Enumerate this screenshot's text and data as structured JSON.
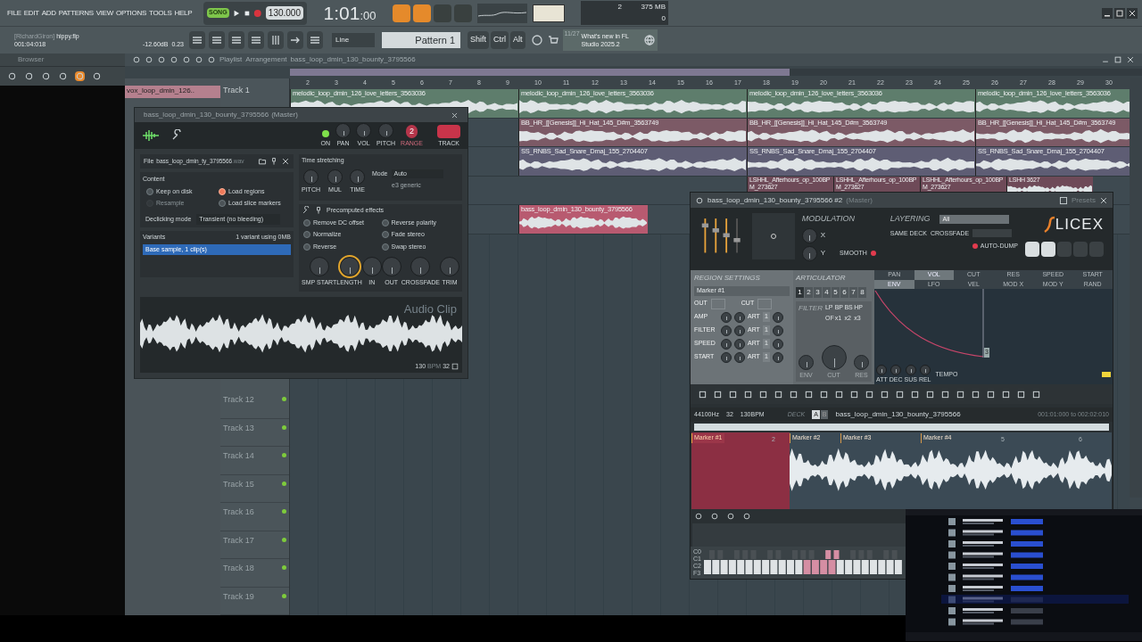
{
  "menu": [
    "FILE",
    "EDIT",
    "ADD",
    "PATTERNS",
    "VIEW",
    "OPTIONS",
    "TOOLS",
    "HELP"
  ],
  "transport": {
    "mode_label": "SONG",
    "song_mode": true,
    "tempo": "130.000",
    "time": "1:01",
    "time_ticks": ":00"
  },
  "project": {
    "user": "[RichardGiron]",
    "file": "hippy.flp",
    "position": "001:04:018",
    "volume": "-12.60dB",
    "pitch": "0.23"
  },
  "snap": "Line",
  "pattern": "Pattern 1",
  "modifiers": [
    "Shift",
    "Ctrl",
    "Alt"
  ],
  "resources": {
    "voices": "2",
    "memory": "375 MB",
    "polyphony": "0"
  },
  "news": {
    "counter": "11/27",
    "text": "What's new in FL Studio 2025.2"
  },
  "browser": {
    "title": "Browser"
  },
  "playlist": {
    "breadcrumb": [
      "Playlist",
      "Arrangement",
      "bass_loop_dmin_130_bounty_3795566"
    ],
    "picker": [
      {
        "label": "vox_loop_dmin_126..",
        "selected": true
      }
    ],
    "ruler": [
      "2",
      "3",
      "4",
      "5",
      "6",
      "7",
      "8",
      "9",
      "10",
      "11",
      "12",
      "13",
      "14",
      "15",
      "16",
      "17",
      "18",
      "19",
      "20",
      "21",
      "22",
      "23",
      "24",
      "25",
      "26",
      "27",
      "28",
      "29",
      "30"
    ],
    "lanes": [
      {
        "color": "#5e7d6c",
        "clips": [
          {
            "kind": "long",
            "label": "melodic_loop_dmin_126_love_letters_3563036"
          },
          {
            "kind": "long",
            "label": "melodic_loop_dmin_126_love_letters_3563036"
          },
          {
            "kind": "long",
            "label": "melodic_loop_dmin_126_love_letters_3563036"
          },
          {
            "kind": "long",
            "label": "melodic_loop_dmin_126_love_letters_3563036"
          }
        ]
      },
      {
        "color": "#7c5a66",
        "clips": [
          {
            "kind": "empty"
          },
          {
            "kind": "long",
            "label": "BB_HR_[[Genesis]]_Hi_Hat_145_D#m_3563749"
          },
          {
            "kind": "long",
            "label": "BB_HR_[[Genesis]]_Hi_Hat_145_D#m_3563749"
          },
          {
            "kind": "long",
            "label": "BB_HR_[[Genesis]]_Hi_Hat_145_D#m_3563749"
          }
        ]
      },
      {
        "color": "#5e5d74",
        "clips": [
          {
            "kind": "empty"
          },
          {
            "kind": "long",
            "label": "SS_RNBS_Sad_Snare_Dmaj_155_2704407"
          },
          {
            "kind": "long",
            "label": "SS_RNBS_Sad_Snare_Dmaj_155_2704407"
          },
          {
            "kind": "long",
            "label": "SS_RNBS_Sad_Snare_Dmaj_155_2704407"
          }
        ]
      },
      {
        "color": "#6e4a58",
        "clips": [
          {
            "kind": "empty"
          },
          {
            "kind": "empty"
          },
          {
            "kind": "short",
            "label": "LSHHL_Afterhours_op_100BPM_273627"
          },
          {
            "kind": "short",
            "label": "LSHHL_Afterhours_op_100BPM_273627"
          },
          {
            "kind": "short",
            "label": "LSHHL_Afterhours_op_100BPM_273627"
          },
          {
            "kind": "short",
            "label": "LSHH 3627"
          }
        ]
      },
      {
        "color": "#b85a70",
        "clips": [
          {
            "kind": "empty"
          },
          {
            "kind": "medium",
            "label": "bass_loop_dmin_130_bounty_3795566"
          }
        ]
      }
    ],
    "tracks_top": [
      {
        "name": "Track 1"
      }
    ],
    "tracks": [
      {
        "name": "Track 12"
      },
      {
        "name": "Track 13"
      },
      {
        "name": "Track 14"
      },
      {
        "name": "Track 15"
      },
      {
        "name": "Track 16"
      },
      {
        "name": "Track 17"
      },
      {
        "name": "Track 18"
      },
      {
        "name": "Track 19"
      }
    ]
  },
  "channel": {
    "title": "bass_loop_dmin_130_bounty_3795566",
    "title_suffix": "(Master)",
    "on": true,
    "on_label": "ON",
    "header_knobs": [
      "PAN",
      "VOL",
      "PITCH"
    ],
    "range": "2",
    "range_label": "RANGE",
    "track_label": "TRACK",
    "file_label": "File",
    "file": "bass_loop_dmin_ty_3795566",
    "file_ext": ".wav",
    "content_title": "Content",
    "content": [
      {
        "label": "Keep on disk",
        "checked": false,
        "disabled": false
      },
      {
        "label": "Load regions",
        "checked": true,
        "disabled": false
      },
      {
        "label": "Resample",
        "checked": false,
        "disabled": true
      },
      {
        "label": "Load slice markers",
        "checked": false,
        "disabled": false
      }
    ],
    "declick_label": "Declicking mode",
    "declick": "Transient (no bleeding)",
    "variants_title": "Variants",
    "variants_info": "1 variant using 0MB",
    "variants": [
      {
        "label": "Base sample, 1 clip(s)",
        "selected": true
      }
    ],
    "stretch_title": "Time stretching",
    "stretch_knobs": [
      "PITCH",
      "MUL",
      "TIME"
    ],
    "mode_label": "Mode",
    "mode": "Auto",
    "mode_engine": "e3 generic",
    "effects_title": "Precomputed effects",
    "effects": [
      {
        "label": "Remove DC offset",
        "checked": false
      },
      {
        "label": "Reverse polarity",
        "checked": false
      },
      {
        "label": "Normalize",
        "checked": false
      },
      {
        "label": "Fade stereo",
        "checked": false
      },
      {
        "label": "Reverse",
        "checked": false
      },
      {
        "label": "Swap stereo",
        "checked": false
      }
    ],
    "effect_knobs": [
      {
        "label": "SMP START",
        "highlighted": false
      },
      {
        "label": "LENGTH",
        "highlighted": true
      },
      {
        "label": "IN",
        "highlighted": false
      },
      {
        "label": "OUT",
        "highlighted": false
      },
      {
        "label": "CROSSFADE",
        "highlighted": false
      },
      {
        "label": "TRIM",
        "highlighted": false
      }
    ],
    "clip_label": "Audio Clip",
    "bpm": "130",
    "bpm_unit": "BPM",
    "beats": "32"
  },
  "slicex": {
    "title": "bass_loop_dmin_130_bounty_3795566 #2",
    "title_suffix": "(Master)",
    "presets": "Presets",
    "modulation": "MODULATION",
    "mod_x": "X",
    "mod_y": "Y",
    "smooth": "SMOOTH",
    "layering": "LAYERING",
    "layer": "All",
    "same_deck": "SAME DECK",
    "crossfade": "CROSSFADE",
    "auto_dump": "AUTO-DUMP",
    "logo": "LICEX",
    "region_settings": "REGION SETTINGS",
    "marker": "Marker #1",
    "articulator": "ARTICULATOR",
    "articulations": [
      {
        "label": "1",
        "selected": true
      },
      {
        "label": "2",
        "selected": false
      },
      {
        "label": "3",
        "selected": false
      },
      {
        "label": "4",
        "selected": false
      },
      {
        "label": "5",
        "selected": false
      },
      {
        "label": "6",
        "selected": false
      },
      {
        "label": "7",
        "selected": false
      },
      {
        "label": "8",
        "selected": false
      }
    ],
    "out": "OUT",
    "cut": "CUT",
    "region_rows": [
      {
        "label": "AMP",
        "art": "ART",
        "value": "1"
      },
      {
        "label": "FILTER",
        "art": "ART",
        "value": "1"
      },
      {
        "label": "SPEED",
        "art": "ART",
        "value": "1"
      },
      {
        "label": "START",
        "art": "ART",
        "value": "1"
      }
    ],
    "filter": "FILTER",
    "filter_types": [
      "LP",
      "BP",
      "BS",
      "HP"
    ],
    "filter_modes": [
      "OF",
      "x1",
      "x2",
      "x3"
    ],
    "filter_knobs": [
      "ENV",
      "CUT",
      "RES"
    ],
    "param_tabs": [
      {
        "label": "PAN",
        "selected": false
      },
      {
        "label": "VOL",
        "selected": true
      },
      {
        "label": "CUT",
        "selected": false
      },
      {
        "label": "RES",
        "selected": false
      },
      {
        "label": "SPEED",
        "selected": false
      },
      {
        "label": "START",
        "selected": false
      }
    ],
    "env_tabs": [
      {
        "label": "ENV",
        "selected": true
      },
      {
        "label": "LFO",
        "selected": false
      },
      {
        "label": "VEL",
        "selected": false
      },
      {
        "label": "MOD X",
        "selected": false
      },
      {
        "label": "MOD Y",
        "selected": false
      },
      {
        "label": "RAND",
        "selected": false
      }
    ],
    "env_knobs": [
      "ATT",
      "DEC",
      "SUS",
      "REL"
    ],
    "tempo": "TEMPO",
    "env_point": "3",
    "sample_rate": "44100Hz",
    "beats": "32",
    "bpm": "130BPM",
    "deck_label": "DECK",
    "decks": [
      {
        "label": "A",
        "selected": true
      },
      {
        "label": "B",
        "selected": false
      }
    ],
    "sample": "bass_loop_dmin_130_bounty_3795566",
    "range": "001:01:000 to 002:02:010",
    "markers": [
      {
        "label": "Marker #1",
        "selected": true
      },
      {
        "label": "Marker #2",
        "selected": false
      },
      {
        "label": "Marker #3",
        "selected": false
      },
      {
        "label": "Marker #4",
        "selected": false
      }
    ],
    "beat_numbers": [
      "2",
      "5",
      "6"
    ],
    "keys": [
      "C0",
      "C1",
      "C2",
      "F3"
    ]
  }
}
